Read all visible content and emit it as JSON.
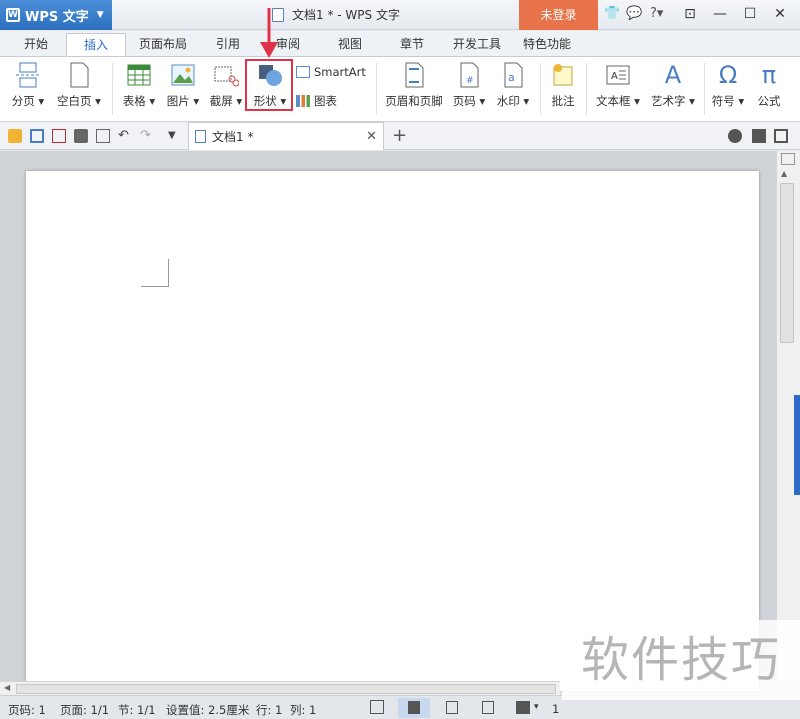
{
  "app": {
    "name": "WPS 文字",
    "window_title": "文档1 * - WPS 文字",
    "login_label": "未登录",
    "help_label": "?"
  },
  "tabs": [
    {
      "label": "开始",
      "active": false
    },
    {
      "label": "插入",
      "active": true
    },
    {
      "label": "页面布局",
      "active": false
    },
    {
      "label": "引用",
      "active": false
    },
    {
      "label": "审阅",
      "active": false
    },
    {
      "label": "视图",
      "active": false
    },
    {
      "label": "章节",
      "active": false
    },
    {
      "label": "开发工具",
      "active": false
    },
    {
      "label": "特色功能",
      "active": false
    }
  ],
  "ribbon": {
    "page_break": "分页",
    "blank_page": "空白页",
    "table": "表格",
    "picture": "图片",
    "screenshot": "截屏",
    "shape": "形状",
    "smartart": "SmartArt",
    "chart": "图表",
    "header_footer": "页眉和页脚",
    "page_number": "页码",
    "watermark": "水印",
    "comment": "批注",
    "textbox": "文本框",
    "wordart": "艺术字",
    "symbol": "符号",
    "formula": "公式",
    "symbol_glyph": "Ω",
    "formula_glyph": "π",
    "wordart_glyph": "A"
  },
  "doc_tab": {
    "title": "文档1 *"
  },
  "status": {
    "page_num": "页码: 1",
    "pages": "页面: 1/1",
    "section": "节: 1/1",
    "setting": "设置值: 2.5厘米",
    "line": "行: 1",
    "column": "列: 1",
    "zoom_partial": "1"
  },
  "overlay_watermark": "软件技巧",
  "colors": {
    "accent": "#2e6bc6",
    "login": "#e8734a",
    "highlight": "#e0334a"
  }
}
